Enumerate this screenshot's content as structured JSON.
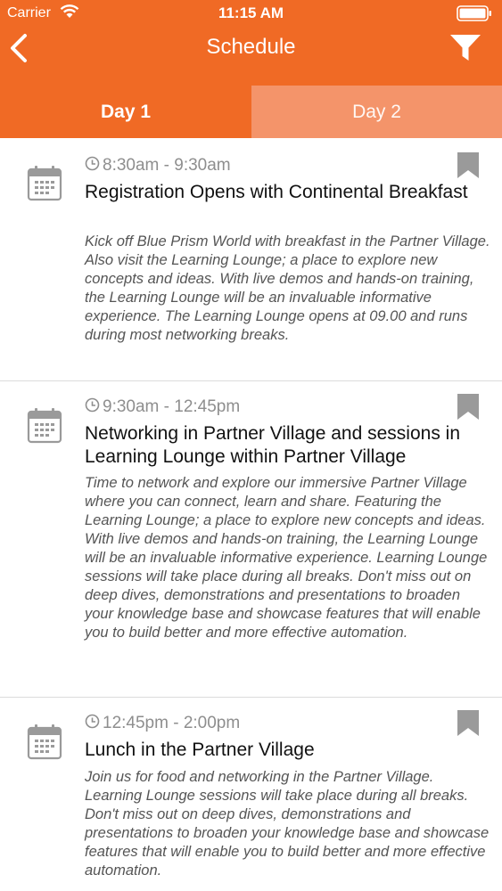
{
  "status_bar": {
    "carrier": "Carrier",
    "time": "11:15 AM"
  },
  "nav": {
    "title": "Schedule",
    "back_icon": "chevron-left-icon",
    "filter_icon": "filter-icon"
  },
  "tabs": [
    {
      "label": "Day 1",
      "selected": true
    },
    {
      "label": "Day 2",
      "selected": false
    }
  ],
  "sessions": [
    {
      "time": "8:30am - 9:30am",
      "title": "Registration Opens with Continental Breakfast",
      "description": "Kick off Blue Prism World with breakfast in the Partner Village. Also visit the Learning Lounge; a place to explore new concepts and ideas.  With live demos and hands-on training, the Learning Lounge will be an invaluable informative experience. The Learning Lounge opens at 09.00 and runs during most networking breaks."
    },
    {
      "time": "9:30am - 12:45pm",
      "title": "Networking in Partner Village and sessions in Learning Lounge within Partner Village",
      "description": "Time to network and explore our immersive Partner Village where you can connect, learn and share. Featuring the Learning Lounge; a place to explore new concepts and ideas.  With live demos and hands-on training, the Learning Lounge will be an invaluable informative experience. Learning Lounge sessions will take place during all breaks.  Don't miss out on deep dives, demonstrations and presentations to broaden your knowledge base and showcase features that will enable you to build better and more effective automation."
    },
    {
      "time": "12:45pm - 2:00pm",
      "title": "Lunch in the Partner Village",
      "description": "Join us for food and networking in the Partner Village. Learning Lounge sessions will take place during all breaks.  Don't miss out on deep dives, demonstrations and presentations to broaden your knowledge base and showcase features that will enable you to build better and more effective automation."
    }
  ],
  "colors": {
    "brand_orange": "#f06a25",
    "inactive_tab": "#f4946a",
    "icon_gray": "#9a9a9a"
  }
}
